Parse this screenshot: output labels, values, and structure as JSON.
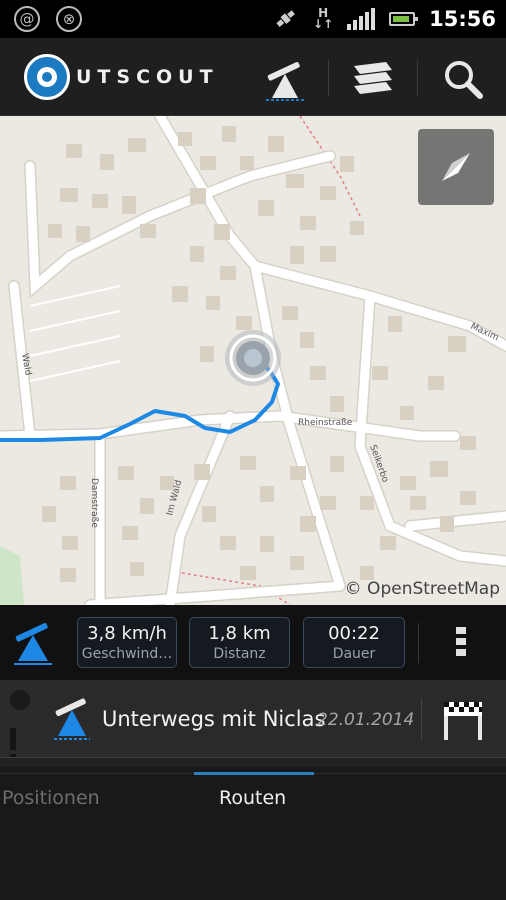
{
  "status_bar": {
    "time": "15:56",
    "left_icons": [
      "at-notification-icon",
      "sync-notification-icon"
    ],
    "network_label": "H",
    "icons": [
      "gps-satellite-icon",
      "hspa-data-icon",
      "signal-strength-icon",
      "battery-icon"
    ]
  },
  "app_bar": {
    "logo_text": "UTSCOUT",
    "actions": [
      "tracking-icon",
      "layers-icon",
      "search-icon"
    ]
  },
  "map": {
    "attribution": "© OpenStreetMap",
    "street_labels": [
      "Rheinstraße",
      "Seikerbo",
      "Damstraße",
      "Im Wald",
      "Wald",
      "Maxim"
    ],
    "track_color": "#1e88e5",
    "compass_button": "compass-icon"
  },
  "stats": {
    "speed": {
      "value": "3,8 km/h",
      "label": "Geschwind…"
    },
    "distance": {
      "value": "1,8 km",
      "label": "Distanz"
    },
    "duration": {
      "value": "00:22",
      "label": "Dauer"
    }
  },
  "route": {
    "name": "Unterwegs mit Niclas",
    "date": "22.01.2014"
  },
  "tabs": [
    {
      "label": "Positionen",
      "selected": false
    },
    {
      "label": "Routen",
      "selected": true
    }
  ],
  "colors": {
    "accent": "#2a7fbf",
    "brand_blue": "#1b7ac0"
  }
}
